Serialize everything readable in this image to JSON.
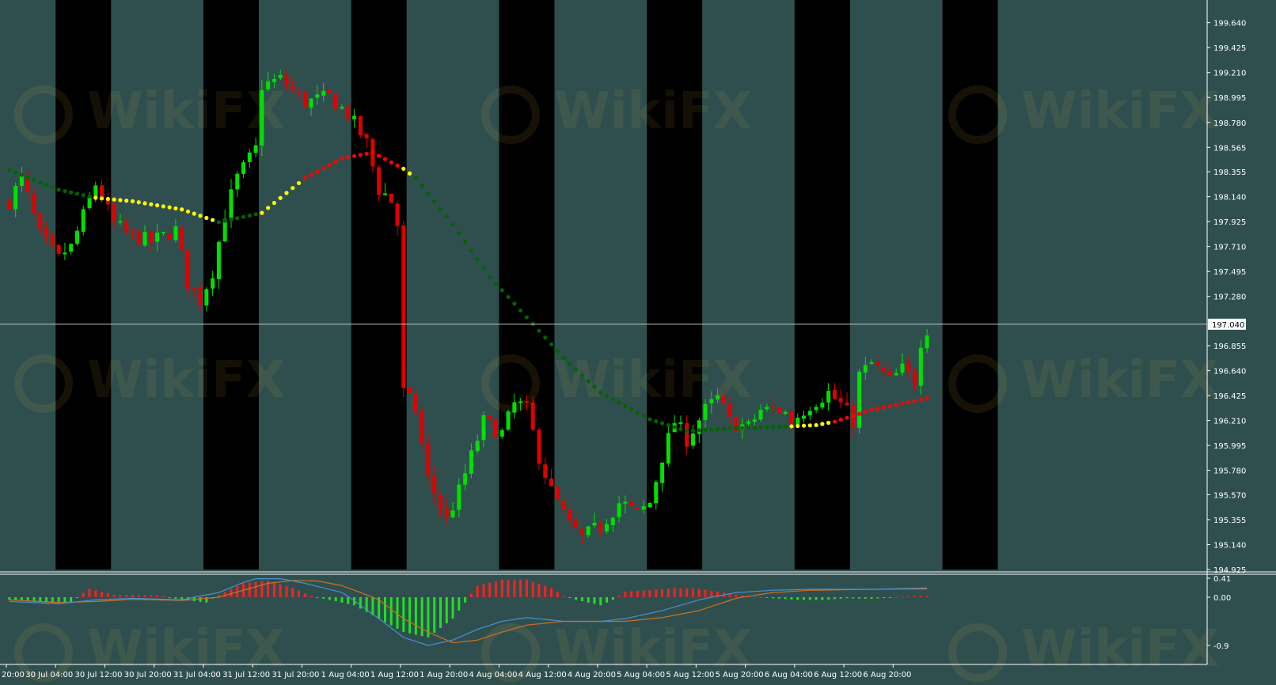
{
  "colors": {
    "background": "#2f4f4f",
    "session_band": "#000000",
    "bull_candle": "#00e000",
    "bear_candle": "#e00000",
    "ma_green": "#006400",
    "ma_yellow": "#ffff00",
    "ma_red": "#ff0000",
    "macd_pos": "#ff2020",
    "macd_neg": "#20e020",
    "signal_line": "#d07020",
    "main_line": "#4a90d0",
    "axis_text": "#ffffff",
    "current_line": "#c0c0c0"
  },
  "watermark": "WikiFX",
  "chart_data": [
    {
      "type": "candlestick",
      "title": "",
      "ylim": [
        194.925,
        199.74
      ],
      "y_ticks": [
        "199.640",
        "199.425",
        "199.210",
        "198.995",
        "198.780",
        "198.565",
        "198.355",
        "198.140",
        "197.925",
        "197.710",
        "197.495",
        "197.280",
        "197.040",
        "196.855",
        "196.640",
        "196.425",
        "196.210",
        "195.995",
        "195.780",
        "195.570",
        "195.355",
        "195.140",
        "194.925"
      ],
      "current_price": "197.040",
      "x_ticks": [
        "20:00",
        "30 Jul 04:00",
        "30 Jul 12:00",
        "30 Jul 20:00",
        "31 Jul 04:00",
        "31 Jul 12:00",
        "31 Jul 20:00",
        "1 Aug 04:00",
        "1 Aug 12:00",
        "1 Aug 20:00",
        "4 Aug 04:00",
        "4 Aug 12:00",
        "4 Aug 20:00",
        "5 Aug 04:00",
        "5 Aug 12:00",
        "5 Aug 20:00",
        "6 Aug 04:00",
        "6 Aug 12:00",
        "6 Aug 20:00"
      ],
      "n_bars": 186,
      "session_bands": [
        [
          8,
          17
        ],
        [
          32,
          41
        ],
        [
          56,
          65
        ],
        [
          80,
          89
        ],
        [
          104,
          113
        ],
        [
          128,
          137
        ],
        [
          152,
          161
        ]
      ],
      "price_anchors": [
        [
          0,
          198.1
        ],
        [
          2,
          198.3
        ],
        [
          5,
          197.8
        ],
        [
          8,
          197.6
        ],
        [
          10,
          197.7
        ],
        [
          14,
          198.25
        ],
        [
          17,
          197.9
        ],
        [
          20,
          197.8
        ],
        [
          23,
          197.75
        ],
        [
          27,
          197.85
        ],
        [
          29,
          197.4
        ],
        [
          31,
          197.25
        ],
        [
          33,
          197.5
        ],
        [
          35,
          198.0
        ],
        [
          37,
          198.3
        ],
        [
          40,
          198.55
        ],
        [
          41,
          199.1
        ],
        [
          44,
          199.15
        ],
        [
          48,
          198.95
        ],
        [
          52,
          199.0
        ],
        [
          55,
          198.85
        ],
        [
          58,
          198.6
        ],
        [
          60,
          198.2
        ],
        [
          62,
          198.1
        ],
        [
          63,
          197.9
        ],
        [
          64,
          196.45
        ],
        [
          66,
          196.3
        ],
        [
          68,
          195.7
        ],
        [
          71,
          195.35
        ],
        [
          73,
          195.6
        ],
        [
          75,
          195.9
        ],
        [
          77,
          196.2
        ],
        [
          80,
          196.1
        ],
        [
          82,
          196.35
        ],
        [
          84,
          196.3
        ],
        [
          86,
          195.9
        ],
        [
          88,
          195.6
        ],
        [
          91,
          195.3
        ],
        [
          93,
          195.2
        ],
        [
          96,
          195.3
        ],
        [
          99,
          195.5
        ],
        [
          102,
          195.4
        ],
        [
          104,
          195.5
        ],
        [
          106,
          195.9
        ],
        [
          108,
          196.2
        ],
        [
          110,
          196.05
        ],
        [
          113,
          196.3
        ],
        [
          115,
          196.4
        ],
        [
          117,
          196.2
        ],
        [
          120,
          196.15
        ],
        [
          122,
          196.3
        ],
        [
          125,
          196.3
        ],
        [
          127,
          196.2
        ],
        [
          130,
          196.35
        ],
        [
          133,
          196.45
        ],
        [
          135,
          196.35
        ],
        [
          137,
          196.2
        ],
        [
          138,
          196.6
        ],
        [
          140,
          196.7
        ],
        [
          143,
          196.55
        ],
        [
          145,
          196.65
        ],
        [
          147,
          196.55
        ],
        [
          148,
          196.9
        ],
        [
          149,
          197.0
        ]
      ],
      "ma_points": [
        [
          0,
          198.37,
          "green"
        ],
        [
          8,
          198.2,
          "green"
        ],
        [
          14,
          198.13,
          "yellow"
        ],
        [
          20,
          198.1,
          "yellow"
        ],
        [
          28,
          198.03,
          "yellow"
        ],
        [
          34,
          197.92,
          "green"
        ],
        [
          41,
          198.0,
          "yellow"
        ],
        [
          48,
          198.3,
          "red"
        ],
        [
          54,
          198.47,
          "red"
        ],
        [
          59,
          198.52,
          "red"
        ],
        [
          64,
          198.38,
          "yellow"
        ],
        [
          66,
          198.3,
          "green"
        ],
        [
          72,
          197.9,
          "green"
        ],
        [
          78,
          197.45,
          "green"
        ],
        [
          84,
          197.1,
          "green"
        ],
        [
          90,
          196.75,
          "green"
        ],
        [
          96,
          196.45,
          "green"
        ],
        [
          104,
          196.22,
          "green"
        ],
        [
          110,
          196.12,
          "green"
        ],
        [
          116,
          196.14,
          "green"
        ],
        [
          122,
          196.15,
          "green"
        ],
        [
          127,
          196.16,
          "yellow"
        ],
        [
          131,
          196.17,
          "yellow"
        ],
        [
          134,
          196.2,
          "red"
        ],
        [
          140,
          196.3,
          "red"
        ],
        [
          149,
          196.4,
          "red"
        ]
      ]
    },
    {
      "type": "macd",
      "title": "",
      "ylim": [
        -0.9,
        0.41
      ],
      "y_ticks": [
        "0.41",
        "0.00",
        "-0.9"
      ],
      "hist_anchors": [
        [
          0,
          -0.05
        ],
        [
          5,
          -0.08
        ],
        [
          10,
          -0.1
        ],
        [
          13,
          0.18
        ],
        [
          17,
          0.05
        ],
        [
          20,
          0.05
        ],
        [
          24,
          0.04
        ],
        [
          28,
          -0.05
        ],
        [
          32,
          -0.1
        ],
        [
          34,
          0.05
        ],
        [
          38,
          0.3
        ],
        [
          42,
          0.36
        ],
        [
          46,
          0.2
        ],
        [
          49,
          0.02
        ],
        [
          52,
          -0.05
        ],
        [
          56,
          -0.15
        ],
        [
          60,
          -0.4
        ],
        [
          64,
          -0.65
        ],
        [
          68,
          -0.75
        ],
        [
          72,
          -0.4
        ],
        [
          74,
          -0.1
        ],
        [
          76,
          0.25
        ],
        [
          80,
          0.38
        ],
        [
          84,
          0.38
        ],
        [
          88,
          0.2
        ],
        [
          90,
          0.02
        ],
        [
          92,
          -0.05
        ],
        [
          96,
          -0.15
        ],
        [
          98,
          -0.05
        ],
        [
          100,
          0.12
        ],
        [
          104,
          0.15
        ],
        [
          108,
          0.2
        ],
        [
          112,
          0.18
        ],
        [
          116,
          0.1
        ],
        [
          120,
          0.02
        ],
        [
          124,
          -0.02
        ],
        [
          128,
          -0.05
        ],
        [
          132,
          -0.05
        ],
        [
          136,
          -0.02
        ],
        [
          140,
          -0.03
        ],
        [
          145,
          0.01
        ],
        [
          149,
          0.03
        ]
      ],
      "main_anchors": [
        [
          0,
          -0.08
        ],
        [
          8,
          -0.12
        ],
        [
          14,
          -0.05
        ],
        [
          20,
          -0.02
        ],
        [
          28,
          -0.05
        ],
        [
          34,
          0.1
        ],
        [
          38,
          0.32
        ],
        [
          40,
          0.4
        ],
        [
          44,
          0.4
        ],
        [
          48,
          0.3
        ],
        [
          54,
          0.1
        ],
        [
          60,
          -0.4
        ],
        [
          64,
          -0.75
        ],
        [
          68,
          -0.9
        ],
        [
          72,
          -0.8
        ],
        [
          76,
          -0.6
        ],
        [
          80,
          -0.45
        ],
        [
          84,
          -0.38
        ],
        [
          90,
          -0.45
        ],
        [
          96,
          -0.45
        ],
        [
          100,
          -0.4
        ],
        [
          106,
          -0.25
        ],
        [
          112,
          -0.05
        ],
        [
          118,
          0.1
        ],
        [
          124,
          0.15
        ],
        [
          130,
          0.17
        ],
        [
          140,
          0.17
        ],
        [
          149,
          0.2
        ]
      ],
      "signal_anchors": [
        [
          0,
          -0.05
        ],
        [
          8,
          -0.1
        ],
        [
          14,
          -0.08
        ],
        [
          20,
          -0.04
        ],
        [
          28,
          -0.06
        ],
        [
          34,
          0.0
        ],
        [
          38,
          0.15
        ],
        [
          42,
          0.3
        ],
        [
          46,
          0.36
        ],
        [
          50,
          0.35
        ],
        [
          54,
          0.25
        ],
        [
          60,
          -0.05
        ],
        [
          64,
          -0.4
        ],
        [
          68,
          -0.65
        ],
        [
          72,
          -0.85
        ],
        [
          76,
          -0.8
        ],
        [
          80,
          -0.65
        ],
        [
          84,
          -0.52
        ],
        [
          90,
          -0.45
        ],
        [
          96,
          -0.45
        ],
        [
          100,
          -0.45
        ],
        [
          106,
          -0.38
        ],
        [
          112,
          -0.25
        ],
        [
          118,
          -0.02
        ],
        [
          124,
          0.1
        ],
        [
          130,
          0.15
        ],
        [
          140,
          0.17
        ],
        [
          149,
          0.18
        ]
      ]
    }
  ]
}
